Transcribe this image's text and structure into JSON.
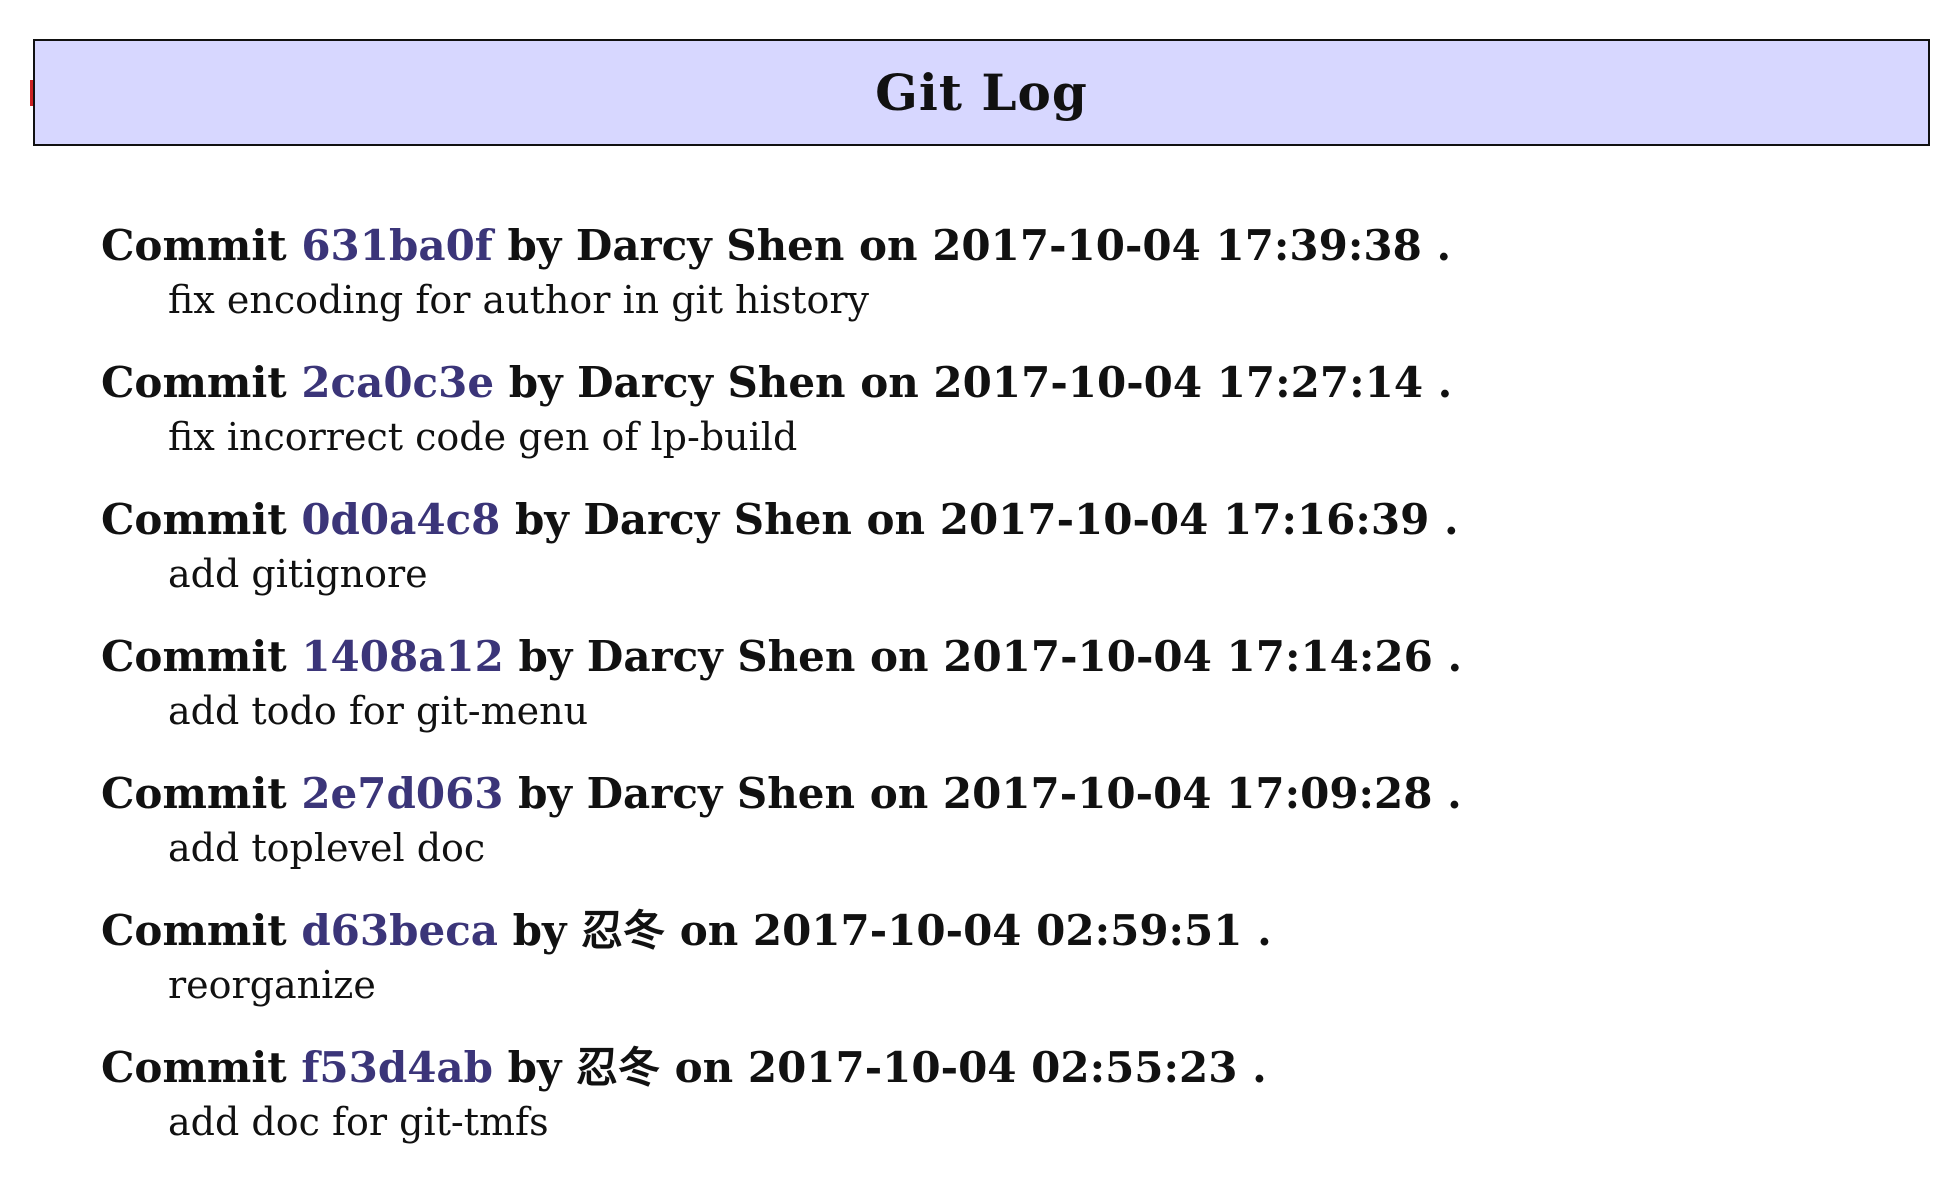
{
  "header": {
    "title": "Git Log"
  },
  "labels": {
    "commit_word": "Commit",
    "by_word": "by",
    "on_word": "on",
    "end_mark": "."
  },
  "colors": {
    "header_background": "#d7d7ff",
    "hash_link": "#3b3579",
    "text": "#111111",
    "cursor_mark": "#cc2222"
  },
  "commits": [
    {
      "hash": "631ba0f",
      "author": "Darcy Shen",
      "date": "2017-10-04 17:39:38",
      "message": "fix encoding for author in git history"
    },
    {
      "hash": "2ca0c3e",
      "author": "Darcy Shen",
      "date": "2017-10-04 17:27:14",
      "message": "fix incorrect code gen of lp-build"
    },
    {
      "hash": "0d0a4c8",
      "author": "Darcy Shen",
      "date": "2017-10-04 17:16:39",
      "message": "add gitignore"
    },
    {
      "hash": "1408a12",
      "author": "Darcy Shen",
      "date": "2017-10-04 17:14:26",
      "message": "add todo for git-menu"
    },
    {
      "hash": "2e7d063",
      "author": "Darcy Shen",
      "date": "2017-10-04 17:09:28",
      "message": "add toplevel doc"
    },
    {
      "hash": "d63beca",
      "author": "忍冬",
      "date": "2017-10-04 02:59:51",
      "message": "reorganize"
    },
    {
      "hash": "f53d4ab",
      "author": "忍冬",
      "date": "2017-10-04 02:55:23",
      "message": "add doc for git-tmfs"
    }
  ]
}
